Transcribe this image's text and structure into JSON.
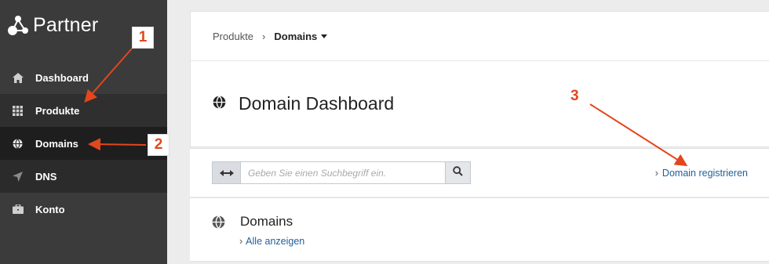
{
  "app": {
    "title": "Partner"
  },
  "sidebar": {
    "items": [
      {
        "label": "Dashboard",
        "icon": "home-icon"
      },
      {
        "label": "Produkte",
        "icon": "grid-icon"
      },
      {
        "label": "Domains",
        "icon": "globe-icon"
      },
      {
        "label": "DNS",
        "icon": "navigation-arrow-icon"
      },
      {
        "label": "Konto",
        "icon": "briefcase-icon"
      }
    ]
  },
  "breadcrumb": {
    "parent": "Produkte",
    "current": "Domains"
  },
  "page": {
    "title": "Domain Dashboard"
  },
  "search": {
    "placeholder": "Geben Sie einen Suchbegriff ein.",
    "value": ""
  },
  "actions": {
    "register": "Domain registrieren"
  },
  "domains": {
    "title": "Domains",
    "all_link": "Alle anzeigen"
  },
  "annotations": {
    "one": "1",
    "two": "2",
    "three": "3"
  },
  "colors": {
    "sidebar_bg": "#3b3b3b",
    "active_bg": "#1e1e1e",
    "link": "#1f5f9b",
    "annotation": "#e2471d"
  }
}
